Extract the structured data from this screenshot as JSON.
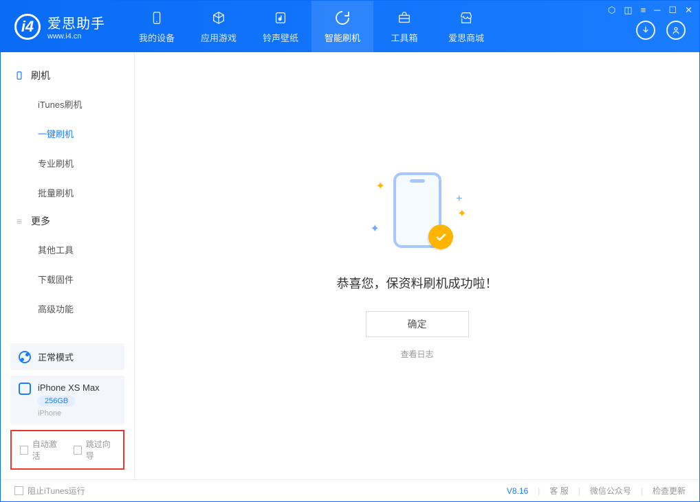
{
  "app": {
    "title": "爱思助手",
    "url": "www.i4.cn"
  },
  "tabs": {
    "device": "我的设备",
    "apps": "应用游戏",
    "ringtones": "铃声壁纸",
    "flash": "智能刷机",
    "toolbox": "工具箱",
    "store": "爱思商城"
  },
  "sidebar": {
    "section_flash": "刷机",
    "items_flash": {
      "itunes": "iTunes刷机",
      "onekey": "一键刷机",
      "pro": "专业刷机",
      "batch": "批量刷机"
    },
    "section_more": "更多",
    "items_more": {
      "other": "其他工具",
      "firmware": "下载固件",
      "advanced": "高级功能"
    }
  },
  "mode_panel": {
    "label": "正常模式"
  },
  "device_panel": {
    "name": "iPhone XS Max",
    "storage": "256GB",
    "type": "iPhone"
  },
  "checkboxes": {
    "auto_activate": "自动激活",
    "skip_guide": "跳过向导"
  },
  "main": {
    "success_message": "恭喜您，保资料刷机成功啦！",
    "ok_button": "确定",
    "view_log": "查看日志"
  },
  "footer": {
    "block_itunes": "阻止iTunes运行",
    "version": "V8.16",
    "support": "客 服",
    "wechat": "微信公众号",
    "check_update": "检查更新"
  }
}
